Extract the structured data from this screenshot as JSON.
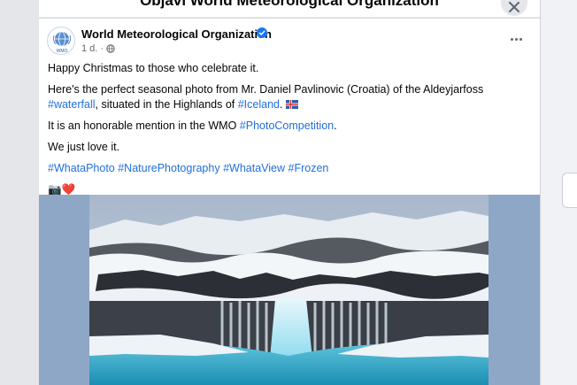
{
  "dialog": {
    "title": "Objavi World Meteorological Organization"
  },
  "post": {
    "author": "World Meteorological Organization",
    "avatar_label": "WMO",
    "time": "1 d.",
    "audience_icon": "globe-icon",
    "line1": "Happy Christmas to those who celebrate it.",
    "line2_a": "Here's the perfect seasonal photo from Mr. Daniel Pavlinovic (Croatia) of the Aldeyjarfoss ",
    "line2_tag1": "#waterfall",
    "line2_b": ", situated in the Highlands of ",
    "line2_tag2": "#Iceland",
    "line2_c": ".",
    "line3_a": "It is an honorable mention in the WMO ",
    "line3_tag": "#PhotoCompetition",
    "line3_b": ".",
    "line4": "We just love it.",
    "hashtags": [
      "#WhataPhoto",
      "#NaturePhotography",
      "#WhataView",
      "#Frozen"
    ],
    "emoji": "📷❤️"
  },
  "colors": {
    "link": "#216fdb",
    "verified": "#1877f2",
    "photo_backdrop": "#8fa7c6"
  }
}
